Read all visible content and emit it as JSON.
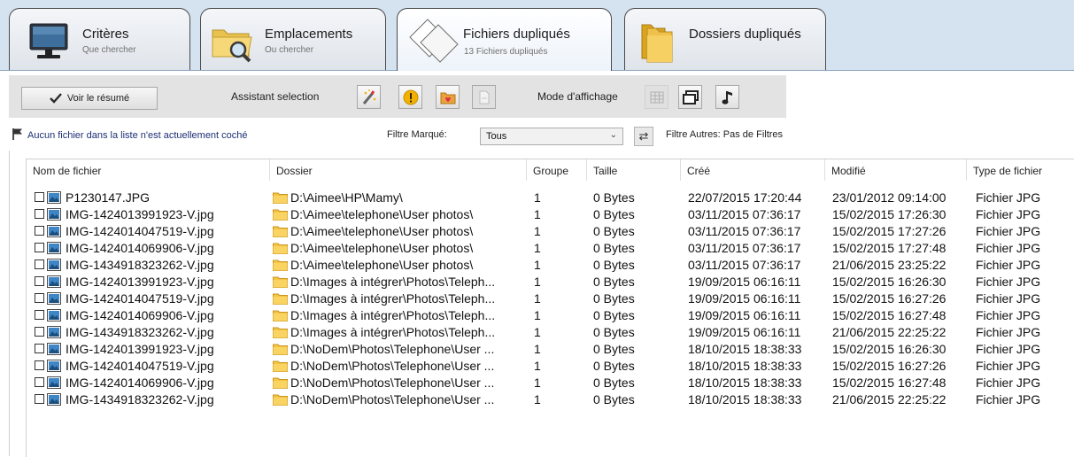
{
  "tabs": [
    {
      "title": "Critères",
      "subtitle": "Que chercher"
    },
    {
      "title": "Emplacements",
      "subtitle": "Ou chercher"
    },
    {
      "title": "Fichiers dupliqués",
      "subtitle": "13 Fichiers dupliqués"
    },
    {
      "title": "Dossiers dupliqués",
      "subtitle": ""
    }
  ],
  "active_tab": 2,
  "toolbar": {
    "resume_label": "Voir le résumé",
    "assistant_label": "Assistant selection",
    "mode_label": "Mode d'affichage"
  },
  "filter": {
    "status_message": "Aucun fichier dans la liste n'est actuellement coché",
    "marked_label": "Filtre Marqué:",
    "marked_value": "Tous",
    "other_label": "Filtre Autres: Pas de Filtres"
  },
  "columns": [
    "Nom de fichier",
    "Dossier",
    "Groupe",
    "Taille",
    "Créé",
    "Modifié",
    "Type de fichier"
  ],
  "rows": [
    {
      "name": "P1230147.JPG",
      "folder": "D:\\Aimee\\HP\\Mamy\\",
      "group": "1",
      "size": "0 Bytes",
      "created": "22/07/2015 17:20:44",
      "modified": "23/01/2012 09:14:00",
      "type": "Fichier JPG"
    },
    {
      "name": "IMG-1424013991923-V.jpg",
      "folder": "D:\\Aimee\\telephone\\User photos\\",
      "group": "1",
      "size": "0 Bytes",
      "created": "03/11/2015 07:36:17",
      "modified": "15/02/2015 17:26:30",
      "type": "Fichier JPG"
    },
    {
      "name": "IMG-1424014047519-V.jpg",
      "folder": "D:\\Aimee\\telephone\\User photos\\",
      "group": "1",
      "size": "0 Bytes",
      "created": "03/11/2015 07:36:17",
      "modified": "15/02/2015 17:27:26",
      "type": "Fichier JPG"
    },
    {
      "name": "IMG-1424014069906-V.jpg",
      "folder": "D:\\Aimee\\telephone\\User photos\\",
      "group": "1",
      "size": "0 Bytes",
      "created": "03/11/2015 07:36:17",
      "modified": "15/02/2015 17:27:48",
      "type": "Fichier JPG"
    },
    {
      "name": "IMG-1434918323262-V.jpg",
      "folder": "D:\\Aimee\\telephone\\User photos\\",
      "group": "1",
      "size": "0 Bytes",
      "created": "03/11/2015 07:36:17",
      "modified": "21/06/2015 23:25:22",
      "type": "Fichier JPG"
    },
    {
      "name": "IMG-1424013991923-V.jpg",
      "folder": "D:\\Images à intégrer\\Photos\\Teleph...",
      "group": "1",
      "size": "0 Bytes",
      "created": "19/09/2015 06:16:11",
      "modified": "15/02/2015 16:26:30",
      "type": "Fichier JPG"
    },
    {
      "name": "IMG-1424014047519-V.jpg",
      "folder": "D:\\Images à intégrer\\Photos\\Teleph...",
      "group": "1",
      "size": "0 Bytes",
      "created": "19/09/2015 06:16:11",
      "modified": "15/02/2015 16:27:26",
      "type": "Fichier JPG"
    },
    {
      "name": "IMG-1424014069906-V.jpg",
      "folder": "D:\\Images à intégrer\\Photos\\Teleph...",
      "group": "1",
      "size": "0 Bytes",
      "created": "19/09/2015 06:16:11",
      "modified": "15/02/2015 16:27:48",
      "type": "Fichier JPG"
    },
    {
      "name": "IMG-1434918323262-V.jpg",
      "folder": "D:\\Images à intégrer\\Photos\\Teleph...",
      "group": "1",
      "size": "0 Bytes",
      "created": "19/09/2015 06:16:11",
      "modified": "21/06/2015 22:25:22",
      "type": "Fichier JPG"
    },
    {
      "name": "IMG-1424013991923-V.jpg",
      "folder": "D:\\NoDem\\Photos\\Telephone\\User ...",
      "group": "1",
      "size": "0 Bytes",
      "created": "18/10/2015 18:38:33",
      "modified": "15/02/2015 16:26:30",
      "type": "Fichier JPG"
    },
    {
      "name": "IMG-1424014047519-V.jpg",
      "folder": "D:\\NoDem\\Photos\\Telephone\\User ...",
      "group": "1",
      "size": "0 Bytes",
      "created": "18/10/2015 18:38:33",
      "modified": "15/02/2015 16:27:26",
      "type": "Fichier JPG"
    },
    {
      "name": "IMG-1424014069906-V.jpg",
      "folder": "D:\\NoDem\\Photos\\Telephone\\User ...",
      "group": "1",
      "size": "0 Bytes",
      "created": "18/10/2015 18:38:33",
      "modified": "15/02/2015 16:27:48",
      "type": "Fichier JPG"
    },
    {
      "name": "IMG-1434918323262-V.jpg",
      "folder": "D:\\NoDem\\Photos\\Telephone\\User ...",
      "group": "1",
      "size": "0 Bytes",
      "created": "18/10/2015 18:38:33",
      "modified": "21/06/2015 22:25:22",
      "type": "Fichier JPG"
    }
  ],
  "icons": {
    "tab_criteria": "monitor-icon",
    "tab_locations": "folder-search-icon",
    "tab_files": "duplicate-files-icon",
    "tab_folders": "folders-icon",
    "resume": "checkmark-icon",
    "assistant": [
      "magic-wand-icon",
      "warning-icon",
      "folder-heart-icon",
      "file-disabled-icon"
    ],
    "mode": [
      "grid-view-icon",
      "windows-view-icon",
      "music-note-icon"
    ],
    "status": "flag-icon",
    "swap": "swap-icon"
  },
  "colors": {
    "tab_strip": "#d5e3f1",
    "status_text": "#1c2f74",
    "folder": "#f5c542",
    "warning": "#f2b100"
  }
}
